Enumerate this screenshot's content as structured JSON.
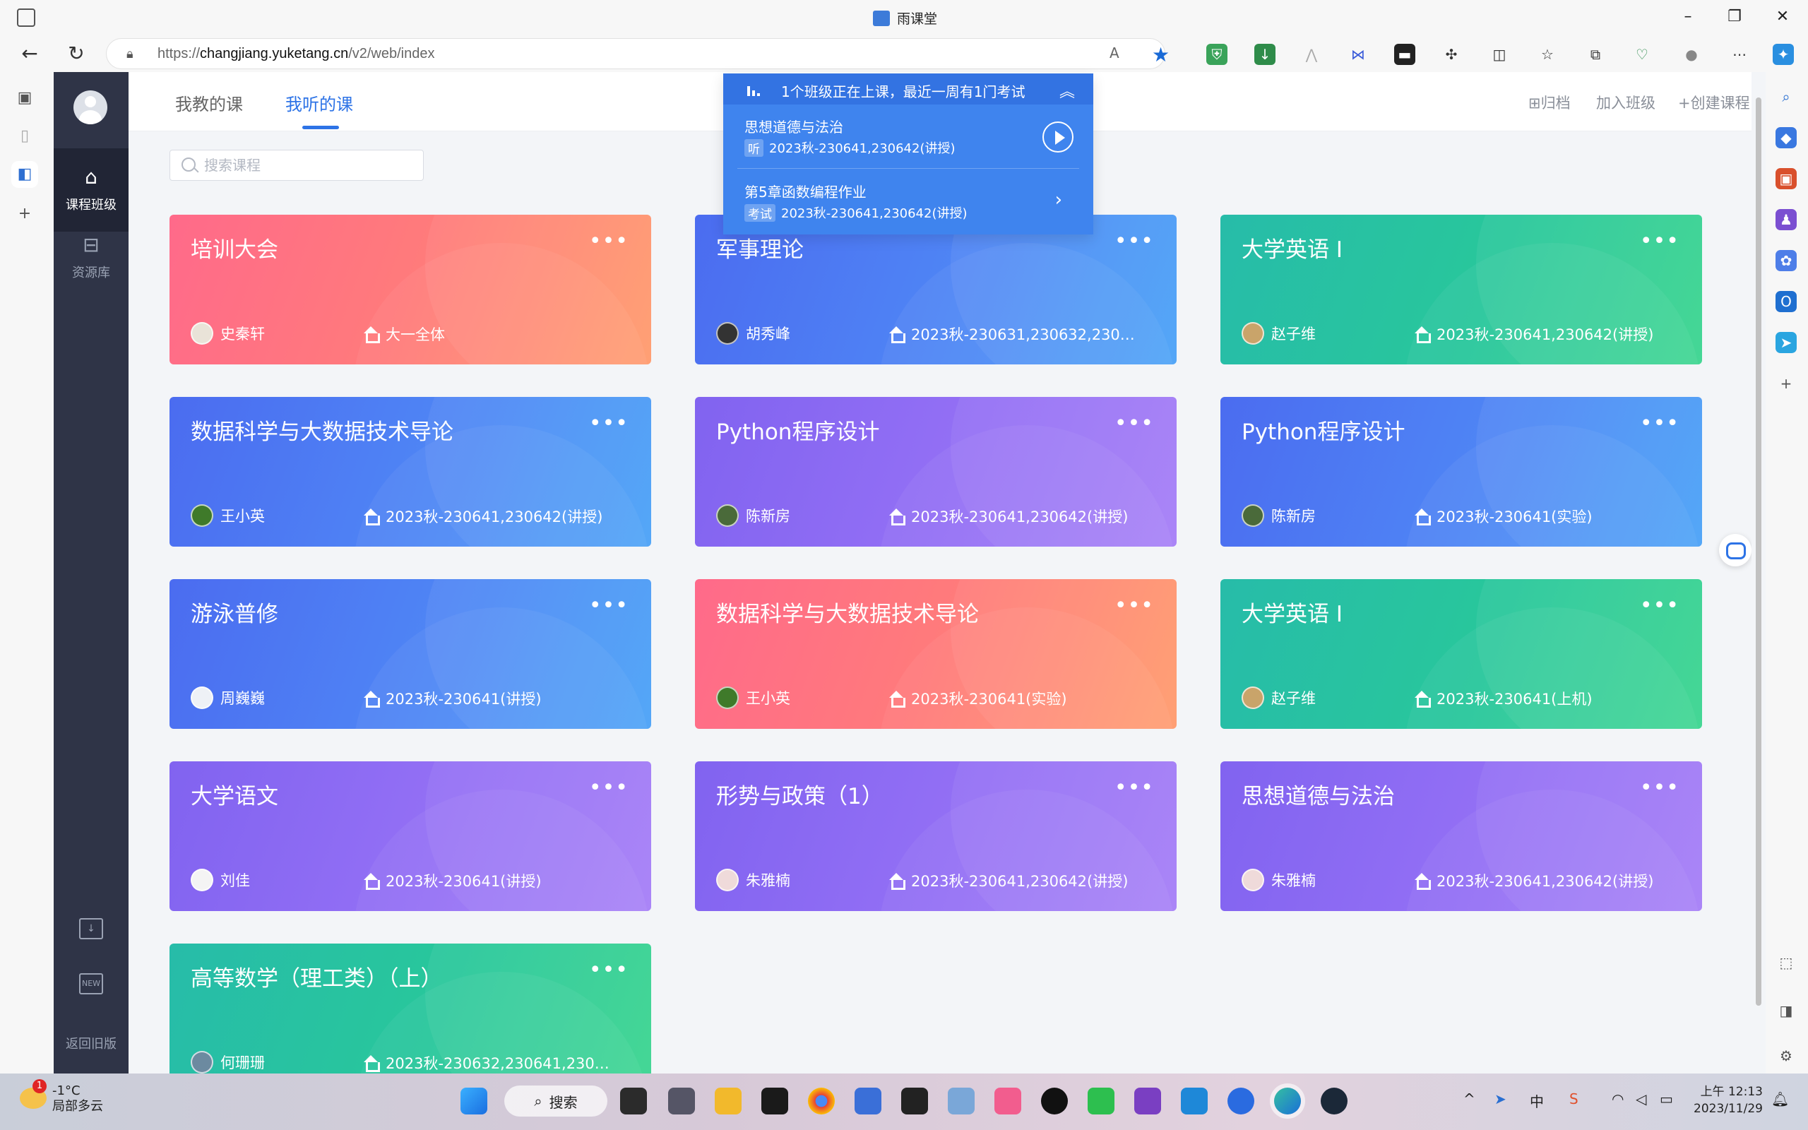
{
  "window": {
    "title": "雨课堂"
  },
  "browser": {
    "url_prefix": "https://",
    "url_host": "changjiang.yuketang.cn",
    "url_path": "/v2/web/index"
  },
  "sidebar": {
    "items": [
      {
        "label": "课程班级"
      },
      {
        "label": "资源库"
      }
    ],
    "back_label": "返回旧版"
  },
  "header": {
    "tabs": [
      {
        "label": "我教的课"
      },
      {
        "label": "我听的课"
      }
    ],
    "actions": {
      "archive": "归档",
      "join": "加入班级",
      "create": "+创建课程"
    }
  },
  "search": {
    "placeholder": "搜索课程"
  },
  "live_popup": {
    "header": "1个班级正在上课，最近一周有1门考试",
    "items": [
      {
        "name": "思想道德与法治",
        "tag": "听",
        "classes": "2023秋-230641,230642(讲授)"
      },
      {
        "name": "第5章函数编程作业",
        "tag": "考试",
        "classes": "2023秋-230641,230642(讲授)"
      }
    ]
  },
  "courses": [
    {
      "title": "培训大会",
      "teacher": "史秦轩",
      "classes": "大一全体",
      "color": "#ff7b7b"
    },
    {
      "title": "军事理论",
      "teacher": "胡秀峰",
      "classes": "2023秋-230631,230632,230…",
      "color": "#4f86f5"
    },
    {
      "title": "大学英语 I",
      "teacher": "赵子维",
      "classes": "2023秋-230641,230642(讲授)",
      "color": "#28c79b"
    },
    {
      "title": "数据科学与大数据技术导论",
      "teacher": "王小英",
      "classes": "2023秋-230641,230642(讲授)",
      "color": "#4f86f5"
    },
    {
      "title": "Python程序设计",
      "teacher": "陈新房",
      "classes": "2023秋-230641,230642(讲授)",
      "color": "#9470f5"
    },
    {
      "title": "Python程序设计",
      "teacher": "陈新房",
      "classes": "2023秋-230641(实验)",
      "color": "#4f86f5"
    },
    {
      "title": "游泳普修",
      "teacher": "周巍巍",
      "classes": "2023秋-230641(讲授)",
      "color": "#4f86f5"
    },
    {
      "title": "数据科学与大数据技术导论",
      "teacher": "王小英",
      "classes": "2023秋-230641(实验)",
      "color": "#ff7b7b"
    },
    {
      "title": "大学英语 I",
      "teacher": "赵子维",
      "classes": "2023秋-230641(上机)",
      "color": "#28c79b"
    },
    {
      "title": "大学语文",
      "teacher": "刘佳",
      "classes": "2023秋-230641(讲授)",
      "color": "#9470f5"
    },
    {
      "title": "形势与政策（1）",
      "teacher": "朱雅楠",
      "classes": "2023秋-230641,230642(讲授)",
      "color": "#9470f5"
    },
    {
      "title": "思想道德与法治",
      "teacher": "朱雅楠",
      "classes": "2023秋-230641,230642(讲授)",
      "color": "#9470f5"
    },
    {
      "title": "高等数学（理工类）（上）",
      "teacher": "何珊珊",
      "classes": "2023秋-230632,230641,230…",
      "color": "#28c79b"
    }
  ],
  "card_menu": "•••",
  "taskbar": {
    "weather_temp": "-1°C",
    "weather_desc": "局部多云",
    "weather_badge": "1",
    "search_label": "搜索",
    "ime": "中",
    "time": "上午 12:13",
    "date": "2023/11/29"
  }
}
